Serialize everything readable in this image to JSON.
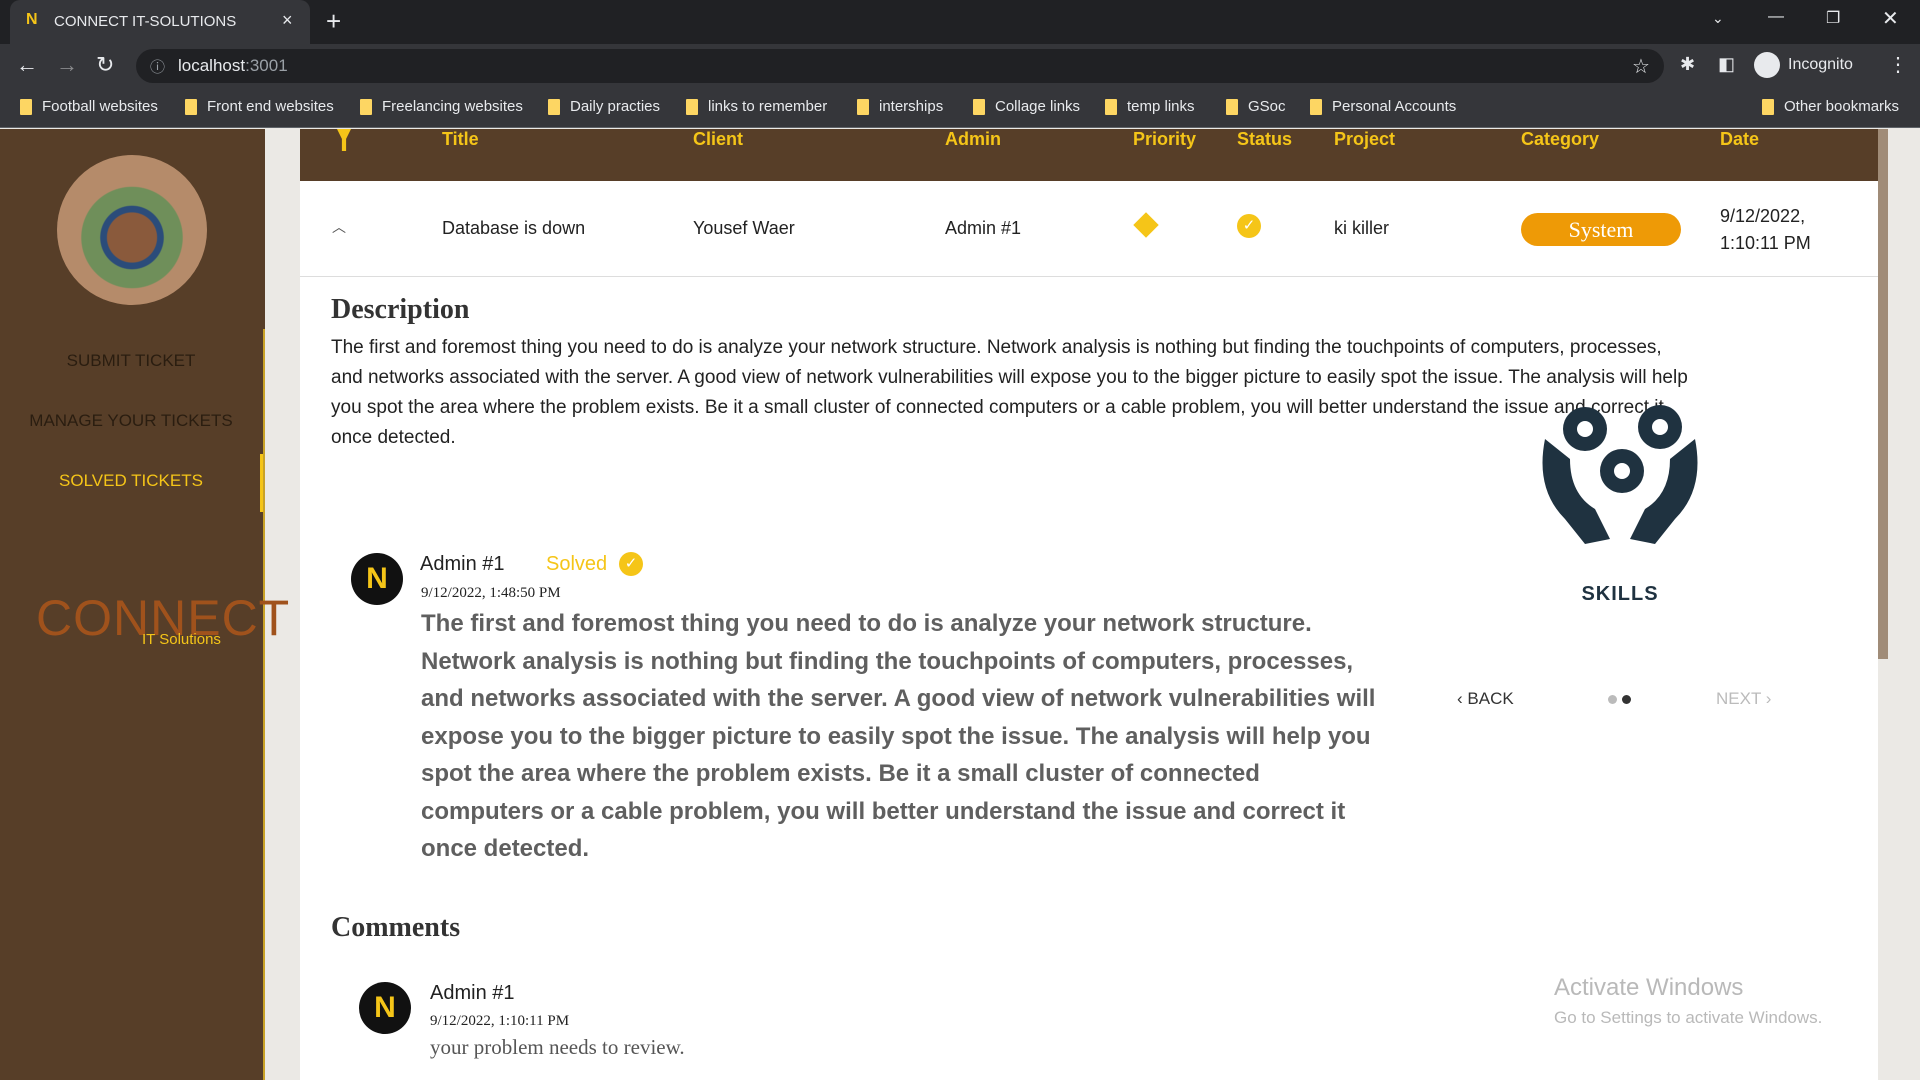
{
  "browser": {
    "tab_title": "CONNECT IT-SOLUTIONS",
    "url_host": "localhost",
    "url_port": ":3001",
    "profile": "Incognito",
    "bookmarks": [
      "Football websites",
      "Front end websites",
      "Freelancing websites",
      "Daily practies",
      "links to remember",
      "interships",
      "Collage links",
      "temp links",
      "GSoc",
      "Personal Accounts"
    ],
    "other_bookmarks": "Other bookmarks"
  },
  "sidebar": {
    "items": [
      {
        "label": "SUBMIT TICKET"
      },
      {
        "label": "MANAGE YOUR TICKETS"
      },
      {
        "label": "SOLVED TICKETS",
        "active": true
      }
    ],
    "logo": {
      "text": "CONNECT",
      "sub": "IT Solutions"
    }
  },
  "table": {
    "headers": [
      "Title",
      "Client",
      "Admin",
      "Priority",
      "Status",
      "Project",
      "Category",
      "Date"
    ],
    "row": {
      "title": "Database is down",
      "client": "Yousef Waer",
      "admin": "Admin #1",
      "priority": "medium",
      "status": "solved",
      "project": "ki killer",
      "category": "System",
      "date_line1": "9/12/2022,",
      "date_line2": "1:10:11 PM"
    }
  },
  "description": {
    "heading": "Description",
    "text": "The first and foremost thing you need to do is analyze your network structure. Network analysis is nothing but finding the touchpoints of computers, processes, and networks associated with the server. A good view of network vulnerabilities will expose you to the bigger picture to easily spot the issue. The analysis will help you spot the area where the problem exists. Be it a small cluster of connected computers or a cable problem, you will better understand the issue and correct it once detected."
  },
  "solution": {
    "author": "Admin #1",
    "status": "Solved",
    "timestamp": "9/12/2022, 1:48:50 PM",
    "text": "The first and foremost thing you need to do is analyze your network structure. Network analysis is nothing but finding the touchpoints of computers, processes, and networks associated with the server. A good view of network vulnerabilities will expose you to the bigger picture to easily spot the issue. The analysis will help you spot the area where the problem exists. Be it a small cluster of connected computers or a cable problem, you will better understand the issue and correct it once detected."
  },
  "carousel": {
    "label": "SKILLS",
    "back": "BACK",
    "next": "NEXT",
    "active_step": 2,
    "steps": 2
  },
  "comments": {
    "heading": "Comments",
    "items": [
      {
        "author": "Admin #1",
        "timestamp": "9/12/2022, 1:10:11 PM",
        "text": "your problem needs to review."
      }
    ]
  },
  "watermark": {
    "title": "Activate Windows",
    "sub": "Go to Settings to activate Windows."
  },
  "colors": {
    "brown": "#573e28",
    "accent": "#f5c518",
    "badge": "#ee9a06"
  }
}
